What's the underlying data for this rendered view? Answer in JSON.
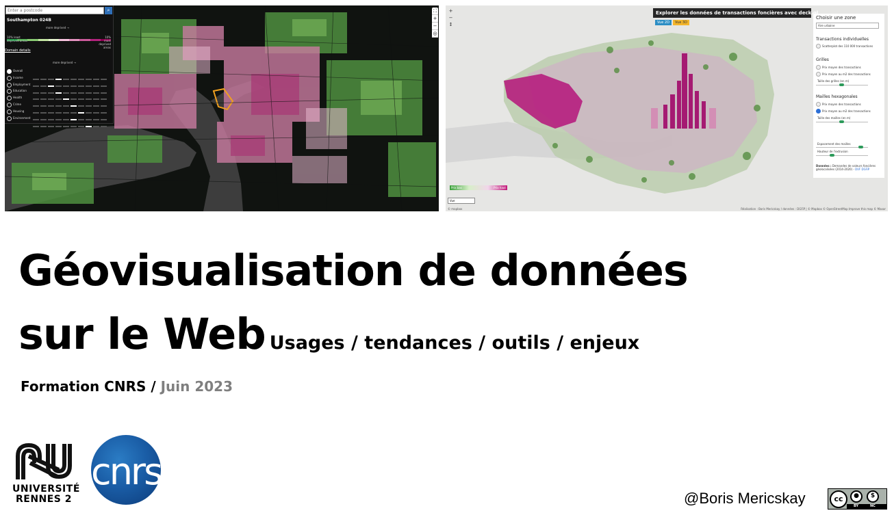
{
  "left_screenshot": {
    "search_placeholder": "Enter a postcode",
    "search_icon": "search-icon",
    "area_name": "Southampton 024B",
    "more_deprived_label": "more deprived →",
    "least_deprived_label": "10% least deprived areas",
    "most_deprived_label": "10% most deprived areas",
    "domain_details_link": "Domain details",
    "more_deprived_label_2": "more deprived →",
    "domains": [
      {
        "label": "Overall",
        "selected": true,
        "mark": 3
      },
      {
        "label": "Income",
        "selected": false,
        "mark": 2
      },
      {
        "label": "Employment",
        "selected": false,
        "mark": 3
      },
      {
        "label": "Education",
        "selected": false,
        "mark": 4
      },
      {
        "label": "Health",
        "selected": false,
        "mark": 5
      },
      {
        "label": "Crime",
        "selected": false,
        "mark": 6
      },
      {
        "label": "Housing",
        "selected": false,
        "mark": 5
      },
      {
        "label": "Environment",
        "selected": false,
        "mark": 7
      }
    ],
    "ramp_colors": [
      "#1a9641",
      "#52b151",
      "#8acb73",
      "#c4e6a3",
      "#e6f5d0",
      "#f7c3de",
      "#e493c0",
      "#cc5a9b",
      "#b3237d",
      "#8e0152"
    ],
    "zoom_in": "+",
    "zoom_out": "−"
  },
  "right_screenshot": {
    "title": "Explorer les données de transactions foncières avec deck.gl",
    "view_2d": "Vue 2D",
    "view_3d": "Vue 3D",
    "zoom_in": "+",
    "zoom_out": "−",
    "zoom_reset": "↕",
    "panel": {
      "zone_heading": "Choisir une zone",
      "zone_value": "Aire urbaine",
      "individual_heading": "Transactions individuelles",
      "individual_option": "Scatterplot des 110 000 transactions",
      "grid_heading": "Grilles",
      "grid_option_1": "Prix moyen des transactions",
      "grid_option_2": "Prix moyen au m2 des transactions",
      "grid_size_label": "Taille des grilles (en m)",
      "hex_heading": "Mailles hexagonales",
      "hex_option_1": "Prix moyen des transactions",
      "hex_option_2": "Prix moyen au m2 des transactions",
      "hex_size_label": "Taille des mailles (en m)",
      "spacing_label": "Espacement des mailles",
      "extrusion_label": "Hauteur de l'extrusion",
      "data_label": "Données :",
      "data_text": "Demandes de valeurs foncières géolocalisées (2014-2020) -",
      "data_link": "DVF DGFiP"
    },
    "legend_low": "Prix bas",
    "legend_high": "Prix haut",
    "legend_box": "Vue",
    "attribution": "Réalisation : Boris Mericskay / données : DGFiP | © Mapbox © OpenStreetMap Improve this map © Maxar",
    "mapbox_logo": "© mapbox"
  },
  "slide": {
    "title_line1": "Géovisualisation de données",
    "title_line2": "sur le Web",
    "subtitle": "Usages / tendances / outils / enjeux",
    "training_prefix": "Formation CNRS /",
    "training_date": "Juin 2023",
    "author": "@Boris Mericskay"
  },
  "logos": {
    "ur2_line1": "UNIVERSITÉ",
    "ur2_line2": "RENNES 2",
    "cnrs": "cnrs",
    "cc_symbol": "cc",
    "cc_by": "BY",
    "cc_nc": "NC",
    "cc_by_icon": "person-icon",
    "cc_nc_icon": "no-dollar-icon"
  }
}
